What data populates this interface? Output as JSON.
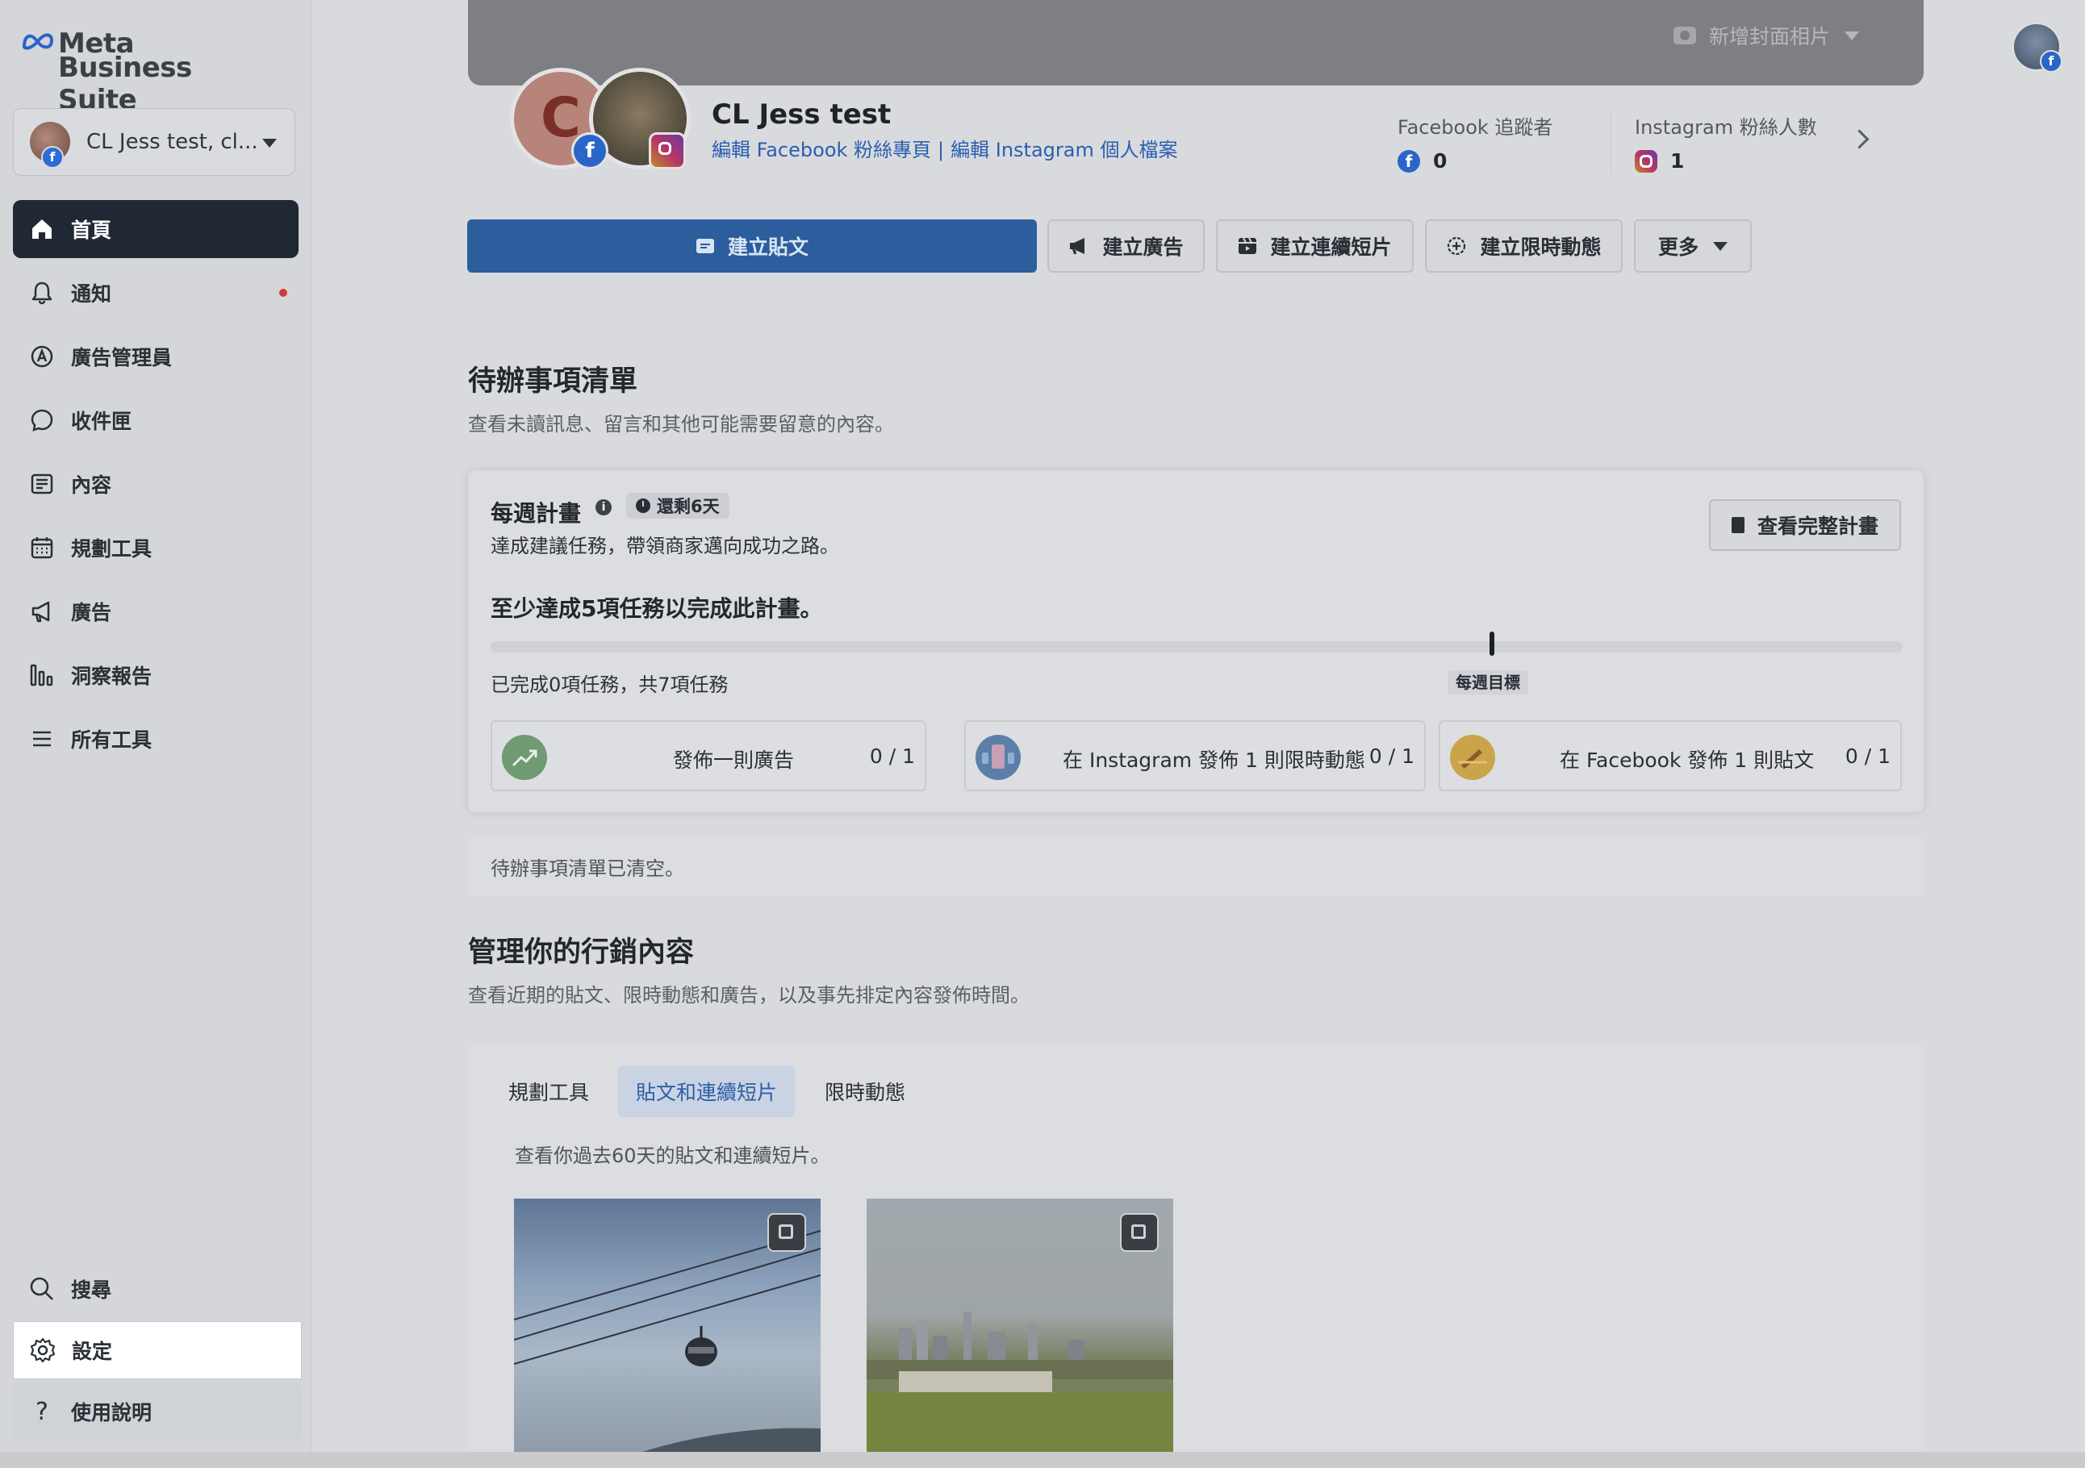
{
  "sidebar": {
    "logo_line1": "Meta",
    "logo_line2": "Business Suite",
    "account_name": "CL Jess test, cl...",
    "items": [
      {
        "label": "首頁",
        "icon": "home-icon",
        "active": true
      },
      {
        "label": "通知",
        "icon": "bell-icon"
      },
      {
        "label": "廣告管理員",
        "icon": "ads-manager-icon"
      },
      {
        "label": "收件匣",
        "icon": "chat-bubble-icon"
      },
      {
        "label": "內容",
        "icon": "content-icon"
      },
      {
        "label": "規劃工具",
        "icon": "calendar-icon"
      },
      {
        "label": "廣告",
        "icon": "megaphone-icon"
      },
      {
        "label": "洞察報告",
        "icon": "bar-chart-icon"
      },
      {
        "label": "所有工具",
        "icon": "menu-icon"
      }
    ],
    "bottom_items": [
      {
        "label": "搜尋",
        "icon": "search-icon"
      },
      {
        "label": "設定",
        "icon": "gear-icon"
      },
      {
        "label": "使用說明",
        "icon": "question-icon"
      }
    ]
  },
  "header": {
    "cover_button": "新增封面相片",
    "page_name": "CL Jess test",
    "edit_facebook": "編輯 Facebook 粉絲專頁",
    "link_separator": "|",
    "edit_instagram": "編輯 Instagram 個人檔案",
    "avatar_letter": "C",
    "facebook_followers_label": "Facebook 追蹤者",
    "facebook_followers_value": "0",
    "instagram_followers_label": "Instagram 粉絲人數",
    "instagram_followers_value": "1"
  },
  "actions": {
    "create_post": "建立貼文",
    "create_ad": "建立廣告",
    "create_reel": "建立連續短片",
    "create_story": "建立限時動態",
    "more": "更多"
  },
  "todo": {
    "title": "待辦事項清單",
    "subtitle": "查看未讀訊息、留言和其他可能需要留意的內容。",
    "empty": "待辦事項清單已清空。"
  },
  "weekly_plan": {
    "title": "每週計畫",
    "time_left": "還剩6天",
    "description": "達成建議任務，帶領商家邁向成功之路。",
    "view_button": "查看完整計畫",
    "goal": "至少達成5項任務以完成此計畫。",
    "progress_text": "已完成0項任務，共7項任務",
    "progress_fraction": 0,
    "goal_label": "每週目標",
    "tasks": [
      {
        "label": "發佈一則廣告",
        "count": "0 / 1"
      },
      {
        "label": "在 Instagram 發佈 1 則限時動態",
        "count": "0 / 1"
      },
      {
        "label": "在 Facebook 發佈 1 則貼文",
        "count": "0 / 1"
      }
    ]
  },
  "marketing": {
    "title": "管理你的行銷內容",
    "subtitle": "查看近期的貼文、限時動態和廣告，以及事先排定內容發佈時間。",
    "tabs": [
      "規劃工具",
      "貼文和連續短片",
      "限時動態"
    ],
    "active_tab": 1,
    "posts_subtitle": "查看你過去60天的貼文和連續短片。"
  },
  "colors": {
    "primary": "#2c5d9d",
    "active_nav": "#1f2833",
    "link": "#2a5fb0",
    "notification_dot": "#d43a3a"
  }
}
